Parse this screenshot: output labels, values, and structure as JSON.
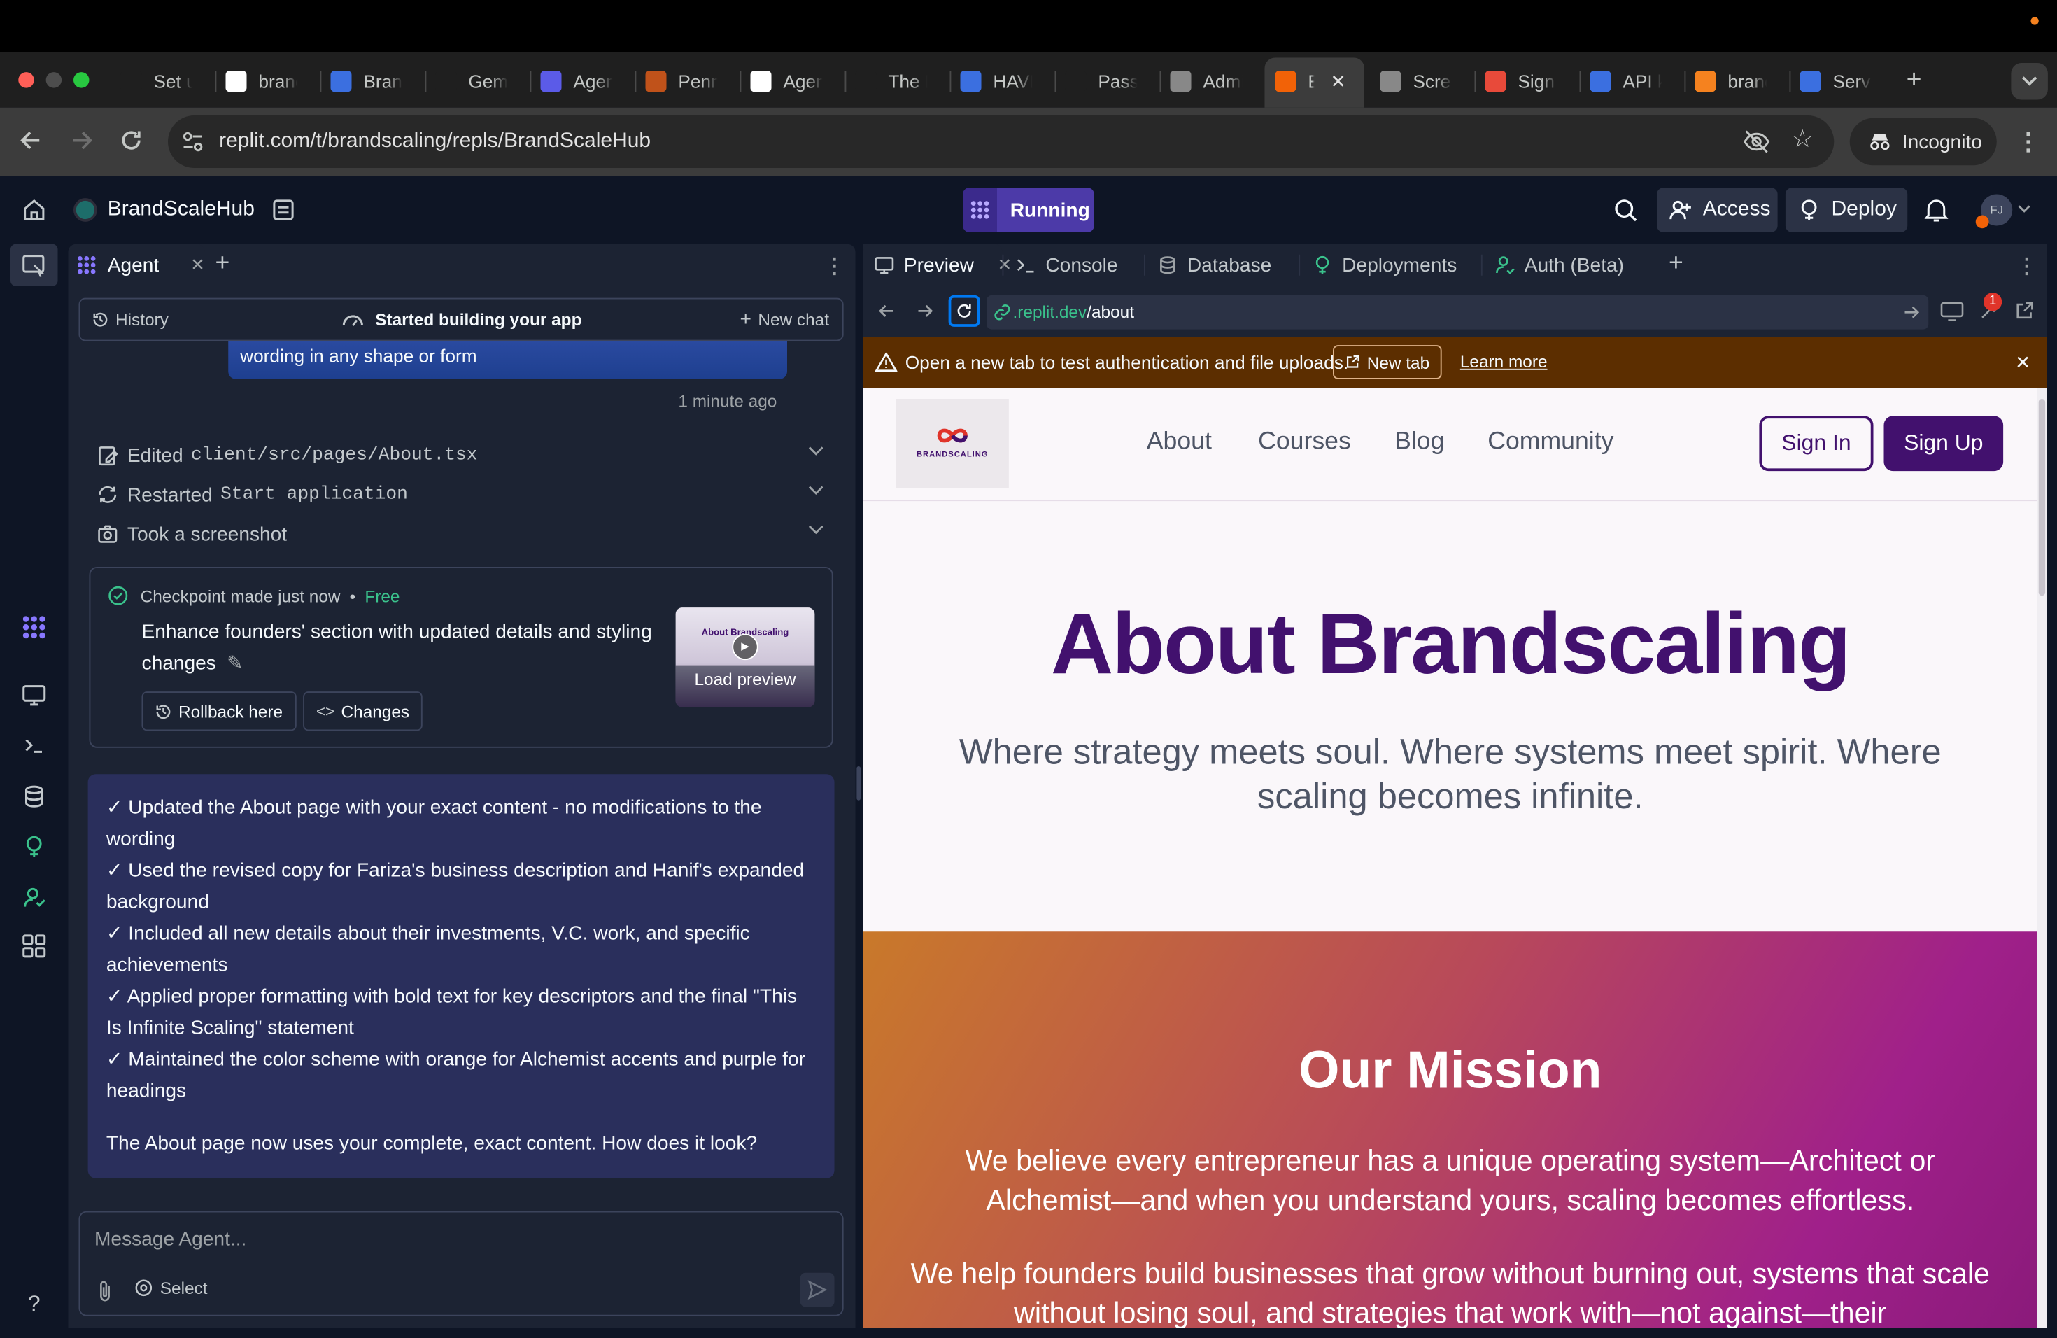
{
  "browser": {
    "tabs": [
      {
        "label": "Set u",
        "color": "#1f1f1f",
        "icon": "replit-swirl-icon"
      },
      {
        "label": "branc",
        "color": "#ffffff",
        "icon": "doc-icon"
      },
      {
        "label": "Branc",
        "color": "#3b6fe0",
        "icon": "dropbox-icon"
      },
      {
        "label": "Gemi",
        "color": "#1f1f1f",
        "icon": "gemini-icon"
      },
      {
        "label": "Agen",
        "color": "#5b5be8",
        "icon": "agent-icon"
      },
      {
        "label": "Penn",
        "color": "#c0521a",
        "icon": "penn-icon"
      },
      {
        "label": "Agen",
        "color": "#ffffff",
        "icon": "triangle-icon"
      },
      {
        "label": "The I",
        "color": "#1f1f1f",
        "icon": "circle-icon"
      },
      {
        "label": "HAVE",
        "color": "#3b6fe0",
        "icon": "dropbox-icon"
      },
      {
        "label": "Pass",
        "color": "#1f1f1f",
        "icon": "upwork-icon"
      },
      {
        "label": "Admi",
        "color": "#888888",
        "icon": "globe-icon"
      },
      {
        "label": "E",
        "color": "#f26207",
        "icon": "replit-icon"
      },
      {
        "label": "Scre",
        "color": "#888888",
        "icon": "globe-icon"
      },
      {
        "label": "Sign",
        "color": "#e84a3a",
        "icon": "sign-icon"
      },
      {
        "label": "API k",
        "color": "#3b6fe0",
        "icon": "api-icon"
      },
      {
        "label": "branc",
        "color": "#f5821f",
        "icon": "fire-icon"
      },
      {
        "label": "Servi",
        "color": "#3b6fe0",
        "icon": "shield-icon"
      }
    ],
    "url": "replit.com/t/brandscaling/repls/BrandScaleHub",
    "incognito_label": "Incognito"
  },
  "header": {
    "project_name": "BrandScaleHub",
    "run_status": "Running",
    "access_label": "Access",
    "deploy_label": "Deploy",
    "avatar_initials": "FJ"
  },
  "agent": {
    "tab_label": "Agent",
    "history_label": "History",
    "status_label": "Started building your app",
    "new_chat_label": "New chat",
    "user_msg_tail": "wording in any shape or form",
    "timestamp": "1 minute ago",
    "actions": [
      {
        "prefix": "Edited",
        "code": "client/src/pages/About.tsx"
      },
      {
        "prefix": "Restarted",
        "code": "Start application"
      },
      {
        "prefix": "Took a screenshot",
        "code": ""
      }
    ],
    "checkpoint": {
      "meta": "Checkpoint made just now",
      "tier": "Free",
      "description": "Enhance founders' section with updated details and styling changes",
      "rollback_label": "Rollback here",
      "changes_label": "Changes",
      "thumb_title": "About Brandscaling",
      "load_preview_label": "Load preview"
    },
    "summary_items": [
      "✓ Updated the About page with your exact content - no modifications to the wording",
      "✓ Used the revised copy for Fariza's business description and Hanif's expanded background",
      "✓ Included all new details about their investments, V.C. work, and specific achievements",
      "✓ Applied proper formatting with bold text for key descriptors and the final \"This Is Infinite Scaling\" statement",
      "✓ Maintained the color scheme with orange for Alchemist accents and purple for headings"
    ],
    "summary_question": "The About page now uses your complete, exact content. How does it look?",
    "input_placeholder": "Message Agent...",
    "select_label": "Select"
  },
  "preview": {
    "tabs": [
      "Preview",
      "Console",
      "Database",
      "Deployments",
      "Auth (Beta)"
    ],
    "url_host": ".replit.dev",
    "url_path": "/about",
    "badge_count": "1",
    "banner_text": "Open a new tab to test authentication and file uploads.",
    "banner_button": "New tab",
    "banner_link": "Learn more"
  },
  "site": {
    "logo_text": "BRANDSCALING",
    "nav": [
      "About",
      "Courses",
      "Blog",
      "Community"
    ],
    "signin_label": "Sign In",
    "signup_label": "Sign Up",
    "hero_title": "About Brandscaling",
    "hero_subtitle": "Where strategy meets soul. Where systems meet spirit. Where scaling becomes infinite.",
    "mission_title": "Our Mission",
    "mission_p1": "We believe every entrepreneur has a unique operating system—Architect or Alchemist—and when you understand yours, scaling becomes effortless.",
    "mission_p2": "We help founders build businesses that grow without burning out, systems that scale without losing soul, and strategies that work with—not against—their",
    "colors": {
      "purple": "#42116e",
      "orange": "#c9792a",
      "magenta": "#a0208a"
    }
  }
}
